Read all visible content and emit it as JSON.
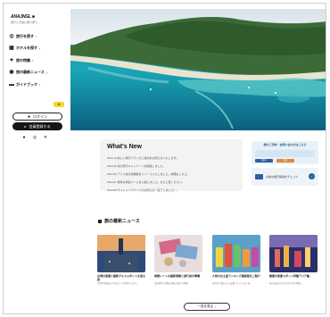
{
  "brand": {
    "logo": "ANAJNGL ■",
    "tagline": "旅行と日常に寄り添う"
  },
  "sidebar": {
    "items": [
      {
        "label": "旅行を探す",
        "icon": "globe-icon"
      },
      {
        "label": "ホテルを探す",
        "icon": "hotel-icon"
      },
      {
        "label": "旅の特集",
        "icon": "star-icon"
      },
      {
        "label": "旅の最新ニュース",
        "icon": "news-icon"
      },
      {
        "label": "ガイドブック",
        "icon": "book-icon"
      }
    ],
    "badge": "★",
    "login_label": "ログイン",
    "signup_label": "会員登録する",
    "social": [
      "facebook-icon",
      "instagram-icon",
      "x-icon"
    ]
  },
  "whats_new": {
    "title": "What's New",
    "items": [
      "2024.10 新しい旅行プランのご案内をお知らせいたします。",
      "2024.09 秋の旅行キャンペーンを開始しました。",
      "2024.08 アプリ版の新機能をリリースいたしました。詳細はこちら。",
      "2024.07 夏休み特集ページを公開しました。ぜひご覧ください。",
      "2024.06 サイトメンテナンスのお知らせ（完了しました）。"
    ]
  },
  "promo": {
    "title": "旅のご予約・お問い合わせはこちら",
    "chip_a": "国内",
    "chip_b": "海外",
    "bottom_text": "お得な旅行情報をチェック",
    "arrow": "›"
  },
  "news": {
    "heading": "旅の最新ニュース",
    "cards": [
      {
        "title": "台湾の夜景と最新グルメスポットを巡る旅",
        "desc": "台北101周辺の人気エリアを紹介します。"
      },
      {
        "title": "両替レートの最新情報と旅行前の準備",
        "desc": "海外旅行の資金計画に役立つ情報。"
      },
      {
        "title": "人気のお土産ランキング最新版をご紹介",
        "desc": "旅行先で買いたい定番アイテムまとめ。"
      },
      {
        "title": "絶景の夜景スポット特集アジア編",
        "desc": "夜のお出かけにおすすめの場所。"
      }
    ],
    "more_label": "一覧を見る",
    "more_arrow": "›"
  },
  "colors": {
    "accent": "#f2d729",
    "brand_blue": "#2c5fa3",
    "sea": "#1aa6b8"
  }
}
